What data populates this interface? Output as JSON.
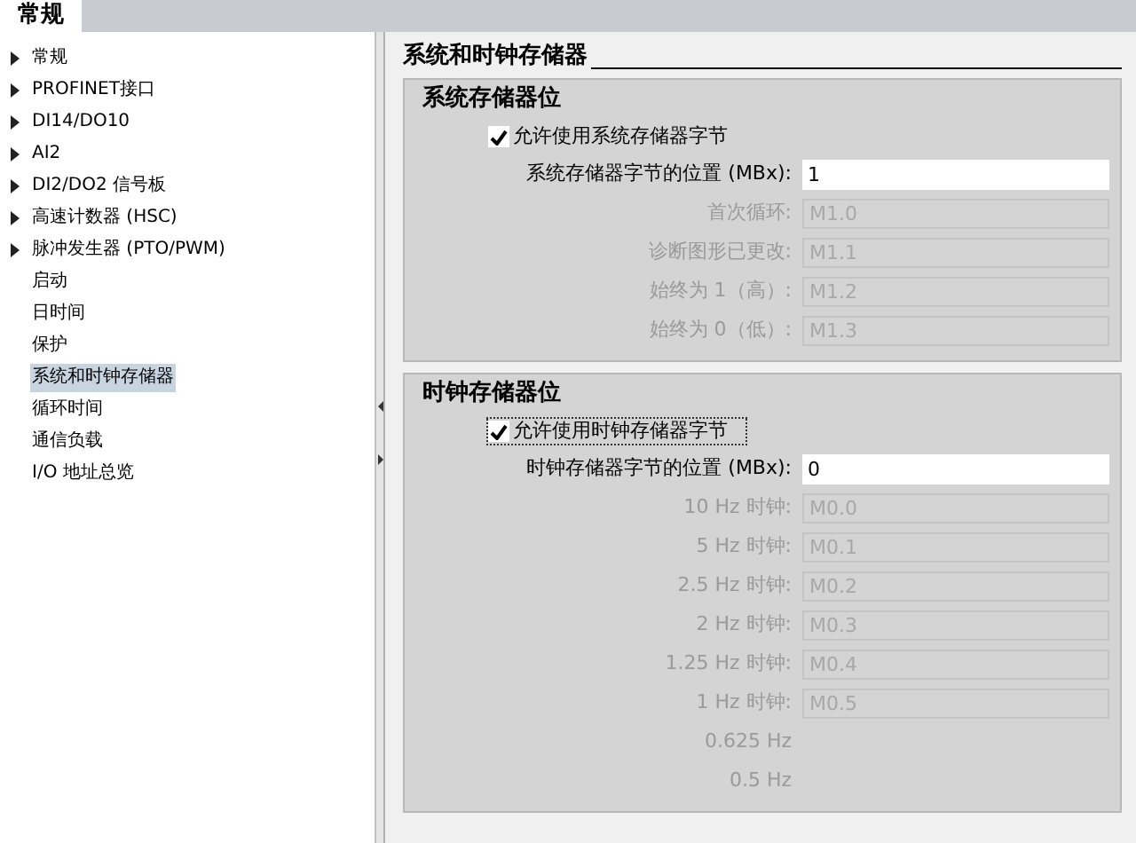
{
  "tabs": [
    {
      "label": "常规",
      "selected": true
    }
  ],
  "nav": {
    "items": [
      {
        "label": "常规",
        "expandable": true,
        "selected": false
      },
      {
        "label": "PROFINET接口",
        "expandable": true,
        "selected": false
      },
      {
        "label": "DI14/DO10",
        "expandable": true,
        "selected": false
      },
      {
        "label": "AI2",
        "expandable": true,
        "selected": false
      },
      {
        "label": "DI2/DO2 信号板",
        "expandable": true,
        "selected": false
      },
      {
        "label": "高速计数器 (HSC)",
        "expandable": true,
        "selected": false
      },
      {
        "label": "脉冲发生器 (PTO/PWM)",
        "expandable": true,
        "selected": false
      },
      {
        "label": "启动",
        "expandable": false,
        "selected": false
      },
      {
        "label": "日时间",
        "expandable": false,
        "selected": false
      },
      {
        "label": "保护",
        "expandable": false,
        "selected": false
      },
      {
        "label": "系统和时钟存储器",
        "expandable": false,
        "selected": true
      },
      {
        "label": "循环时间",
        "expandable": false,
        "selected": false
      },
      {
        "label": "通信负载",
        "expandable": false,
        "selected": false
      },
      {
        "label": "I/O 地址总览",
        "expandable": false,
        "selected": false
      }
    ]
  },
  "page_title": "系统和时钟存储器",
  "sections": [
    {
      "title": "系统存储器位",
      "checkbox": {
        "label": "允许使用系统存储器字节",
        "checked": true,
        "focused": false
      },
      "fields": [
        {
          "label": "系统存储器字节的位置 (MBx):",
          "value": "1",
          "disabled": false
        },
        {
          "label": "首次循环:",
          "value": "M1.0",
          "disabled": true
        },
        {
          "label": "诊断图形已更改:",
          "value": "M1.1",
          "disabled": true
        },
        {
          "label": "始终为 1（高）:",
          "value": "M1.2",
          "disabled": true
        },
        {
          "label": "始终为 0（低）:",
          "value": "M1.3",
          "disabled": true
        }
      ]
    },
    {
      "title": "时钟存储器位",
      "checkbox": {
        "label": "允许使用时钟存储器字节",
        "checked": true,
        "focused": true
      },
      "fields": [
        {
          "label": "时钟存储器字节的位置 (MBx):",
          "value": "0",
          "disabled": false
        },
        {
          "label": "10 Hz 时钟:",
          "value": "M0.0",
          "disabled": true
        },
        {
          "label": "5 Hz 时钟:",
          "value": "M0.1",
          "disabled": true
        },
        {
          "label": "2.5 Hz 时钟:",
          "value": "M0.2",
          "disabled": true
        },
        {
          "label": "2 Hz 时钟:",
          "value": "M0.3",
          "disabled": true
        },
        {
          "label": "1.25 Hz 时钟:",
          "value": "M0.4",
          "disabled": true
        },
        {
          "label": "1 Hz 时钟:",
          "value": "M0.5",
          "disabled": true
        },
        {
          "label": "0.625 Hz",
          "disabled": true
        },
        {
          "label": "0.5 Hz",
          "disabled": true
        }
      ]
    }
  ]
}
